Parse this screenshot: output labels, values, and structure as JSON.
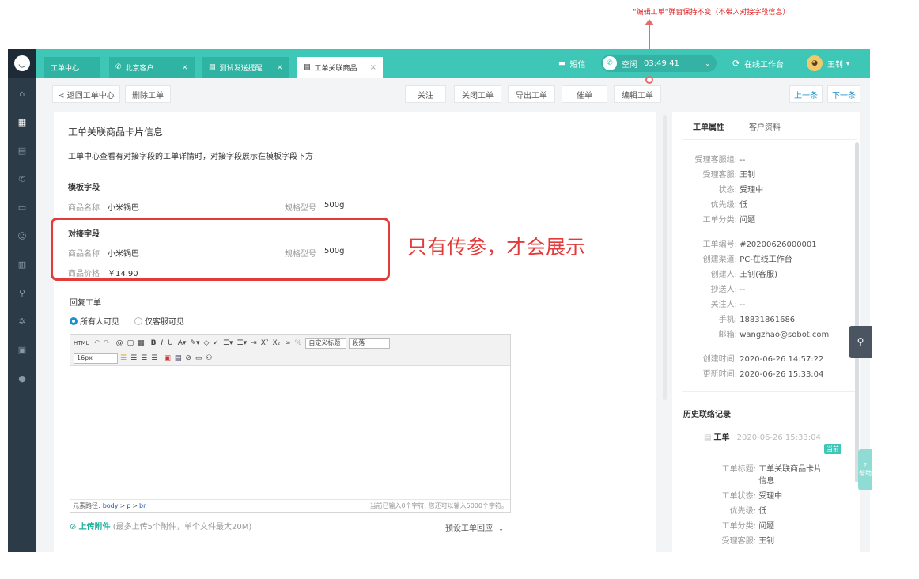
{
  "annotation": {
    "top_note": "“编辑工单”弹窗保持不变（不带入对接字段信息）",
    "box_note": "只有传参，才会展示"
  },
  "colors": {
    "accent": "#3ec6b6",
    "sidebar": "#2c3b48",
    "highlight": "#e33a3a",
    "link": "#1a8fd1"
  },
  "tabs": [
    {
      "label": "工单中心",
      "icon": "",
      "close": ""
    },
    {
      "label": "北京客户",
      "icon": "phone-icon",
      "close": "×"
    },
    {
      "label": "测试发送提醒",
      "icon": "doc-icon",
      "close": "×"
    },
    {
      "label": "工单关联商品",
      "icon": "doc-icon",
      "close": "×"
    }
  ],
  "header": {
    "sms": "短信",
    "status": "空闲",
    "timer": "03:49:41",
    "workspace": "在线工作台",
    "user": "王钊"
  },
  "toolbar": {
    "back": "< 返回工单中心",
    "delete": "删除工单",
    "follow": "关注",
    "close": "关闭工单",
    "export": "导出工单",
    "urge": "催单",
    "edit": "编辑工单",
    "prev": "上一条",
    "next": "下一条"
  },
  "main": {
    "title": "工单关联商品卡片信息",
    "desc": "工单中心查看有对接字段的工单详情时，对接字段展示在模板字段下方",
    "template_section": "模板字段",
    "template_fields": [
      {
        "label": "商品名称",
        "value": "小米锅巴"
      },
      {
        "label": "规格型号",
        "value": "500g"
      }
    ],
    "docking_section": "对接字段",
    "docking_fields": [
      {
        "label": "商品名称",
        "value": "小米锅巴"
      },
      {
        "label": "规格型号",
        "value": "500g"
      },
      {
        "label": "商品价格",
        "value": "￥14.90"
      }
    ],
    "reply_title": "回复工单",
    "visibility": {
      "all": "所有人可见",
      "staff": "仅客服可见",
      "selected": "all"
    }
  },
  "editor": {
    "html_btn": "HTML",
    "format_sel": "自定义标题",
    "para_sel": "段落",
    "size_sel": "16px",
    "path_label": "元素路径:",
    "path": [
      "body",
      "p",
      "br"
    ],
    "counter": "当前已输入0个字符, 您还可以输入5000个字符。"
  },
  "upload": {
    "label": "上传附件",
    "hint": "(最多上传5个附件，单个文件最大20M)",
    "preset": "预设工单回应"
  },
  "right": {
    "tab_active": "工单属性",
    "tab_other": "客户资料",
    "attrs": [
      {
        "k": "受理客服组:",
        "v": "--"
      },
      {
        "k": "受理客服:",
        "v": "王钊"
      },
      {
        "k": "状态:",
        "v": "受理中"
      },
      {
        "k": "优先级:",
        "v": "低"
      },
      {
        "k": "工单分类:",
        "v": "问题"
      }
    ],
    "info": [
      {
        "k": "工单编号:",
        "v": "#20200626000001"
      },
      {
        "k": "创建渠道:",
        "v": "PC-在线工作台"
      },
      {
        "k": "创建人:",
        "v": "王钊(客服)"
      },
      {
        "k": "抄送人:",
        "v": "--"
      },
      {
        "k": "关注人:",
        "v": "--"
      },
      {
        "k": "手机:",
        "v": "18831861686"
      },
      {
        "k": "邮箱:",
        "v": "wangzhao@sobot.com"
      }
    ],
    "times": [
      {
        "k": "创建时间:",
        "v": "2020-06-26 14:57:22"
      },
      {
        "k": "更新时间:",
        "v": "2020-06-26 15:33:04"
      }
    ],
    "history_title": "历史联络记录",
    "history_item": {
      "type": "工单",
      "time": "2020-06-26 15:33:04",
      "badge": "当前"
    },
    "history_fields": [
      {
        "k": "工单标题:",
        "v": "工单关联商品卡片"
      },
      {
        "k": "",
        "v": "信息"
      },
      {
        "k": "工单状态:",
        "v": "受理中"
      },
      {
        "k": "优先级:",
        "v": "低"
      },
      {
        "k": "工单分类:",
        "v": "问题"
      },
      {
        "k": "受理客服:",
        "v": "王钊"
      }
    ]
  },
  "floats": {
    "help": "帮助"
  }
}
